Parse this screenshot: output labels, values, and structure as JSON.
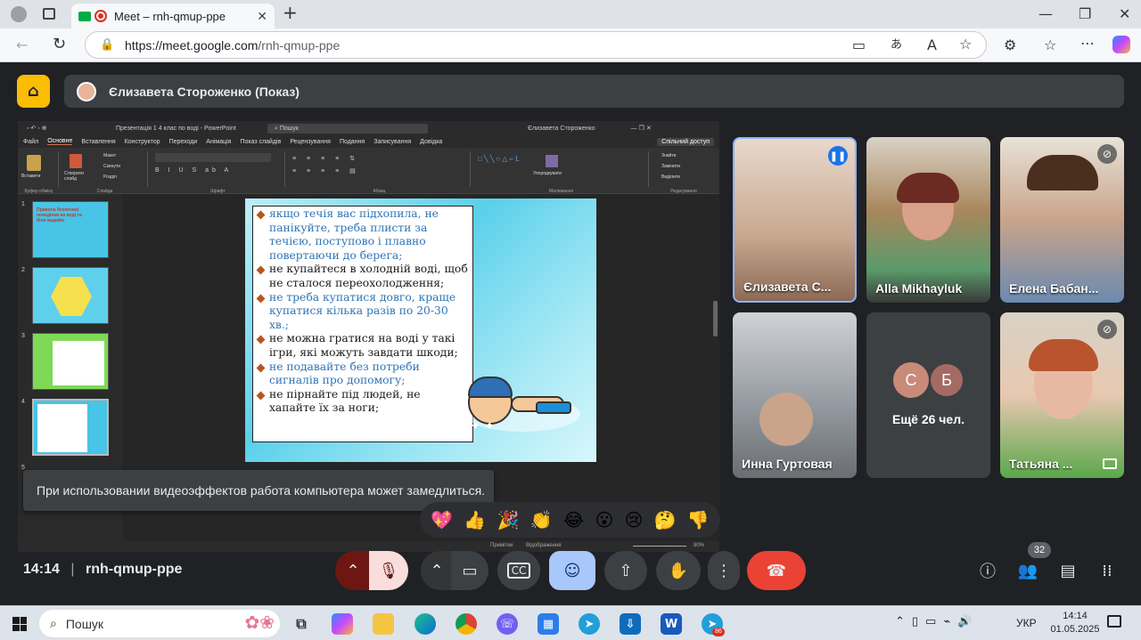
{
  "browser": {
    "tab_title": "Meet – rnh-qmup-ppe",
    "url_host": "https://meet.google.com",
    "url_path": "/rnh-qmup-ppe"
  },
  "meet": {
    "presenter_banner": "Єлизавета Стороженко (Показ)",
    "tooltip": "При использовании видеоэффектов работа компьютера может замедлиться.",
    "time": "14:14",
    "meeting_code": "rnh-qmup-ppe",
    "participants_count": "32",
    "reactions": [
      "💖",
      "👍",
      "🎉",
      "👏",
      "😂",
      "😮",
      "😢",
      "🤔",
      "👎"
    ],
    "accent_end_call": "#ea4335",
    "accent_active": "#a8c7fa"
  },
  "tiles": [
    {
      "name": "Єлизавета С...",
      "speaking": true
    },
    {
      "name": "Alla Mikhayluk",
      "muted": false
    },
    {
      "name": "Елена Бабан...",
      "muted": true
    },
    {
      "name": "Инна Гуртовая",
      "muted": false
    },
    {
      "name": "Ещё 26 чел.",
      "avatars": [
        "С",
        "Б"
      ]
    },
    {
      "name": "Татьяна ...",
      "muted": true
    }
  ],
  "powerpoint": {
    "doc_title": "Презентація 1 4 клас по воді - PowerPoint",
    "search": "Пошук",
    "user": "Єлизавета Стороженко",
    "menu": [
      "Файл",
      "Основне",
      "Вставлення",
      "Конструктор",
      "Переходи",
      "Анімація",
      "Показ слайдів",
      "Рецензування",
      "Подання",
      "Записування",
      "Довідка"
    ],
    "share_button": "Спільний доступ",
    "ribbon_groups": [
      "Буфер обміну",
      "Слайди",
      "Шрифт",
      "Абзац",
      "Малювання",
      "Редагування"
    ],
    "ribbon_items": [
      "Вставити",
      "Створити слайд",
      "Макет",
      "Скинути",
      "Розділ",
      "Упорядкувати",
      "Знайти",
      "Замінити",
      "Виділити"
    ],
    "thumbs": [
      "1",
      "2",
      "3",
      "4",
      "5"
    ],
    "thumb1_title": "Правила безпечної поведінки на воді та біля водойм",
    "status": "Примітки",
    "status_views": "Відображення",
    "zoom": "80%"
  },
  "slide": {
    "items": [
      {
        "text": "якщо течія вас підхопила, не панікуйте, треба плисти за течією, поступово і плавно повертаючи до берега;",
        "color": "blue"
      },
      {
        "text": "не купайтеся в холодній воді, щоб не сталося переохолодження;",
        "color": "dark"
      },
      {
        "text": "не треба купатися довго, краще купатися кілька разів по 20-30 хв.;",
        "color": "blue"
      },
      {
        "text": "не можна гратися на воді у такі ігри, які можуть завдати шкоди;",
        "color": "dark"
      },
      {
        "text": "не подавайте без потреби сигналів про допомогу;",
        "color": "blue"
      },
      {
        "text": "не пірнайте під людей, не хапайте їх за ноги;",
        "color": "dark"
      }
    ]
  },
  "taskbar": {
    "search": "Пошук",
    "lang": "УКР",
    "time": "14:14",
    "date": "01.05.2025",
    "telegram_badge": "86"
  }
}
